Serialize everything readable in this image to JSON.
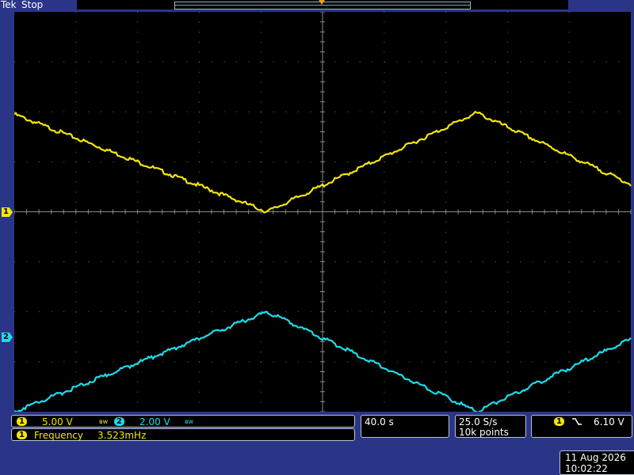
{
  "header": {
    "brand": "Tek",
    "state": "Stop"
  },
  "colors": {
    "ch1": "#f2e60a",
    "ch2": "#1cdce8",
    "frame": "#2a3588",
    "trigger_marker": "#f29a1c"
  },
  "channels": [
    {
      "number": "1",
      "scale": "5.00 V",
      "bw_icon": "bandwidth-limit-icon"
    },
    {
      "number": "2",
      "scale": "2.00 V",
      "bw_icon": "bandwidth-limit-icon"
    }
  ],
  "measurement": {
    "channel": "1",
    "label": "Frequency",
    "value": "3.523mHz"
  },
  "timebase": {
    "scale": "40.0 s"
  },
  "acquisition": {
    "sample_rate": "25.0 S/s",
    "record_length": "10k points"
  },
  "trigger": {
    "channel": "1",
    "slope_icon": "falling-edge-icon",
    "level": "6.10 V"
  },
  "datetime": {
    "date": "11 Aug 2026",
    "time": "10:02:22"
  },
  "chart_data": {
    "type": "line",
    "x_divisions": 10,
    "y_divisions": 8,
    "series": [
      {
        "x": [
          0,
          4.1,
          7.5,
          10
        ],
        "y": [
          1.95,
          0,
          1.98,
          0.55
        ]
      },
      {
        "x": [
          0,
          4.1,
          7.5,
          10
        ],
        "y": [
          -4.0,
          -2.0,
          -4.0,
          -2.55
        ]
      }
    ]
  }
}
